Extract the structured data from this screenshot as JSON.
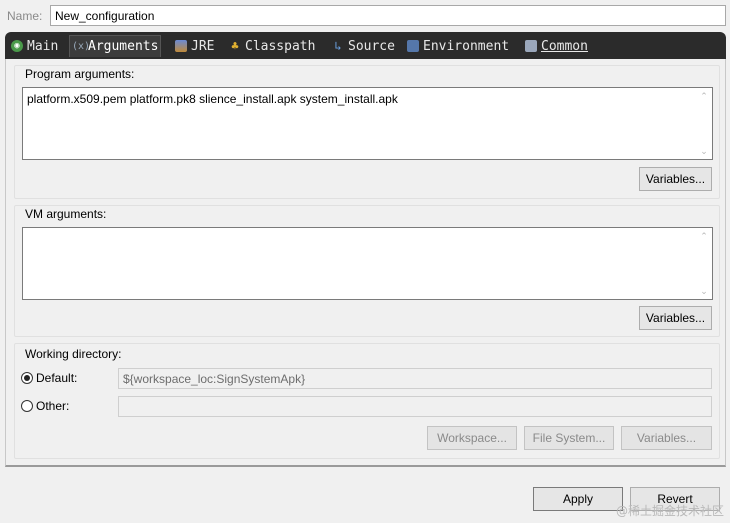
{
  "name_field": {
    "label": "Name:",
    "value": "New_configuration"
  },
  "tabs": [
    {
      "label": "Main",
      "icon": "main-icon"
    },
    {
      "label": "Arguments",
      "icon": "arguments-icon",
      "active": true
    },
    {
      "label": "JRE",
      "icon": "jre-icon"
    },
    {
      "label": "Classpath",
      "icon": "classpath-icon"
    },
    {
      "label": "Source",
      "icon": "source-icon"
    },
    {
      "label": "Environment",
      "icon": "environment-icon"
    },
    {
      "label": "Common",
      "icon": "common-icon"
    }
  ],
  "program_arguments": {
    "title": "Program arguments:",
    "value": "platform.x509.pem platform.pk8 slience_install.apk system_install.apk",
    "variables_button": "Variables..."
  },
  "vm_arguments": {
    "title": "VM arguments:",
    "value": "",
    "variables_button": "Variables..."
  },
  "working_directory": {
    "title": "Working directory:",
    "default_label": "Default:",
    "default_value": "${workspace_loc:SignSystemApk}",
    "other_label": "Other:",
    "other_value": "",
    "workspace_button": "Workspace...",
    "file_system_button": "File System...",
    "variables_button": "Variables..."
  },
  "footer": {
    "apply_button": "Apply",
    "revert_button": "Revert"
  },
  "watermark": "@稀土掘金技术社区"
}
